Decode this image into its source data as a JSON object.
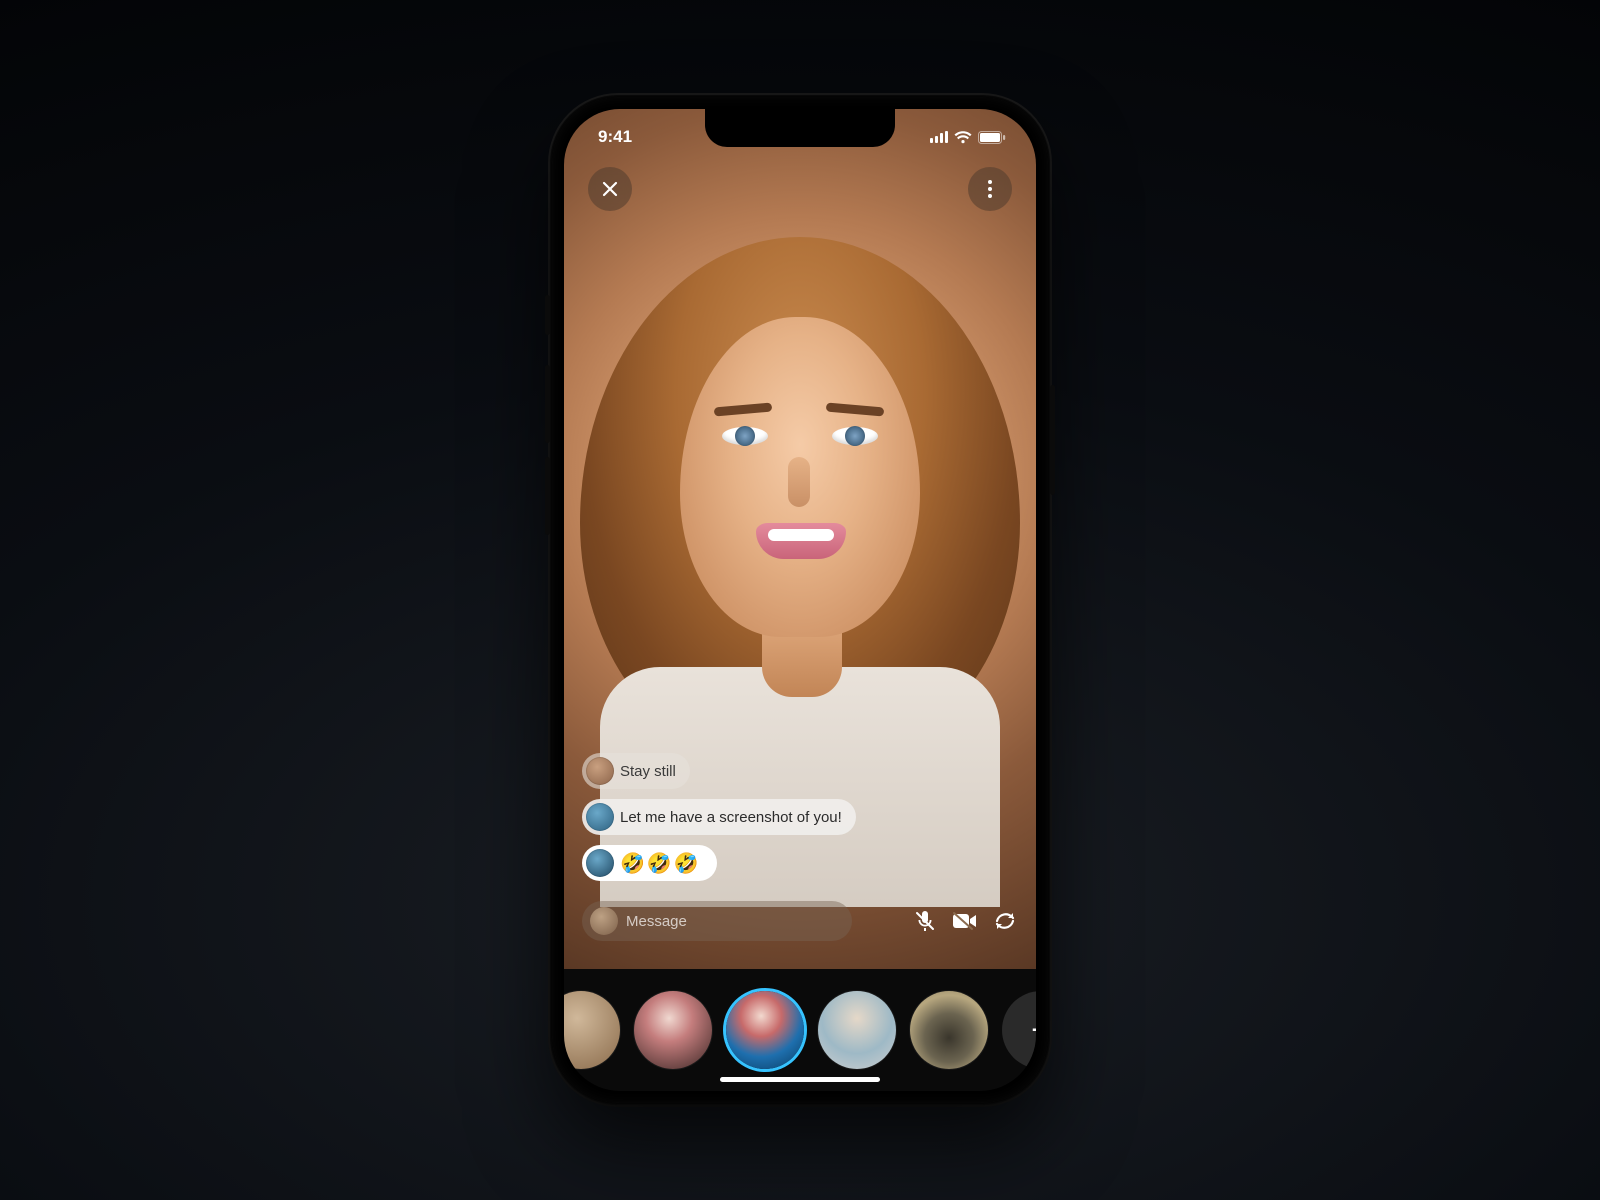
{
  "statusbar": {
    "time": "9:41"
  },
  "topbar": {
    "close_icon": "close",
    "more_icon": "more-vertical"
  },
  "chat": {
    "messages": [
      {
        "text": "Stay still",
        "avatar": "user-1"
      },
      {
        "text": "Let me have a screenshot of you!",
        "avatar": "user-2"
      },
      {
        "text": "🤣🤣🤣",
        "avatar": "user-3",
        "emoji": true
      }
    ]
  },
  "input": {
    "placeholder": "Message"
  },
  "controls": {
    "mute_icon": "microphone-off",
    "video_icon": "video-off",
    "flip_icon": "camera-flip"
  },
  "participants": {
    "items": [
      {
        "id": "participant-0"
      },
      {
        "id": "participant-1"
      },
      {
        "id": "participant-2",
        "active": true
      },
      {
        "id": "participant-3"
      },
      {
        "id": "participant-4"
      }
    ],
    "add_label": "+"
  }
}
